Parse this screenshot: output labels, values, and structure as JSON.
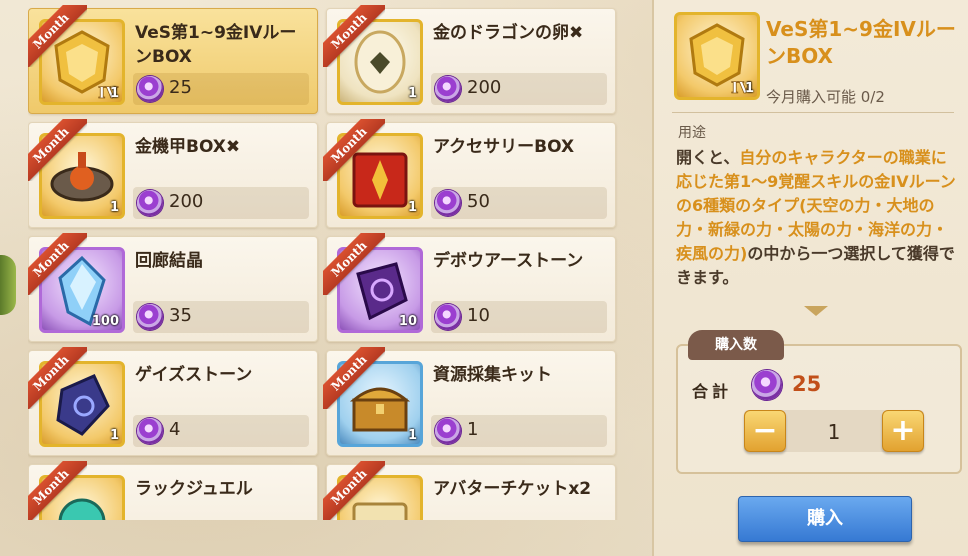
{
  "ribbon_label": "Month",
  "items": [
    {
      "name": "VeS第1~9金IVルーンBOX",
      "price": "25",
      "count": "1",
      "selected": true,
      "frame": "gold",
      "icon": "rune-box-icon"
    },
    {
      "name": "金のドラゴンの卵✖",
      "price": "200",
      "count": "1",
      "selected": false,
      "frame": "gold",
      "icon": "dragon-egg-icon"
    },
    {
      "name": "金機甲BOX✖",
      "price": "200",
      "count": "1",
      "selected": false,
      "frame": "gold",
      "icon": "mech-box-icon"
    },
    {
      "name": "アクセサリーBOX",
      "price": "50",
      "count": "1",
      "selected": false,
      "frame": "gold",
      "icon": "accessory-box-icon"
    },
    {
      "name": "回廊結晶",
      "price": "35",
      "count": "100",
      "selected": false,
      "frame": "purple",
      "icon": "crystal-icon"
    },
    {
      "name": "デボウアーストーン",
      "price": "10",
      "count": "10",
      "selected": false,
      "frame": "purple",
      "icon": "devour-stone-icon"
    },
    {
      "name": "ゲイズストーン",
      "price": "4",
      "count": "1",
      "selected": false,
      "frame": "gold",
      "icon": "gaze-stone-icon"
    },
    {
      "name": "資源採集キット",
      "price": "1",
      "count": "1",
      "selected": false,
      "frame": "blue",
      "icon": "treasure-chest-icon"
    },
    {
      "name": "ラックジュエル",
      "price": "",
      "count": "",
      "selected": false,
      "frame": "gold",
      "icon": "luck-jewel-icon"
    },
    {
      "name": "アバターチケットx2",
      "price": "",
      "count": "",
      "selected": false,
      "frame": "gold",
      "icon": "avatar-ticket-icon"
    }
  ],
  "detail": {
    "title": "VeS第1~9金IVルーンBOX",
    "count": "1",
    "limit": "今月購入可能 0/2",
    "usage_label": "用途",
    "desc_1": "開くと、",
    "desc_2": "自分のキャラクターの職業に応じた第1～9覚醒スキルの金IVルーンの6種類のタイプ(天空の力・大地の力・新緑の力・太陽の力・海洋の力・疾風の力)",
    "desc_3": "の中から一つ選択して獲得できます。"
  },
  "purchase": {
    "tab_label": "購入数",
    "total_label": "合計",
    "total_value": "25",
    "quantity": "1",
    "minus_label": "−",
    "plus_label": "+",
    "buy_label": "購入"
  },
  "colors": {
    "accent": "#d8901c",
    "ribbon": "#c8442a",
    "buy": "#3e82d8"
  }
}
